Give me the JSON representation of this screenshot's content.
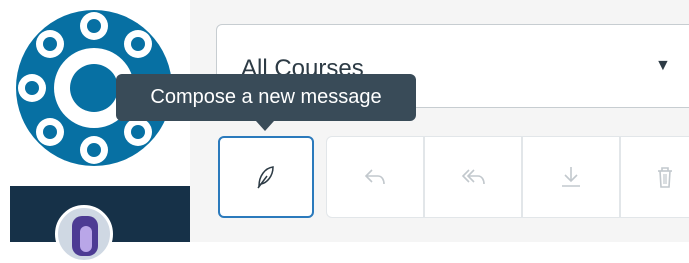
{
  "course_filter": {
    "selected": "All Courses"
  },
  "tooltip": {
    "text": "Compose a new message"
  },
  "toolbar": {
    "buttons": [
      {
        "name": "compose",
        "icon": "feather-icon"
      },
      {
        "name": "reply",
        "icon": "reply-icon"
      },
      {
        "name": "reply-all",
        "icon": "reply-all-icon"
      },
      {
        "name": "archive",
        "icon": "download-icon"
      },
      {
        "name": "delete",
        "icon": "trash-icon"
      }
    ]
  },
  "colors": {
    "brand": "#0770A3",
    "nav_dark": "#163148",
    "focus": "#2b7abc",
    "tooltip_bg": "#394b58"
  }
}
